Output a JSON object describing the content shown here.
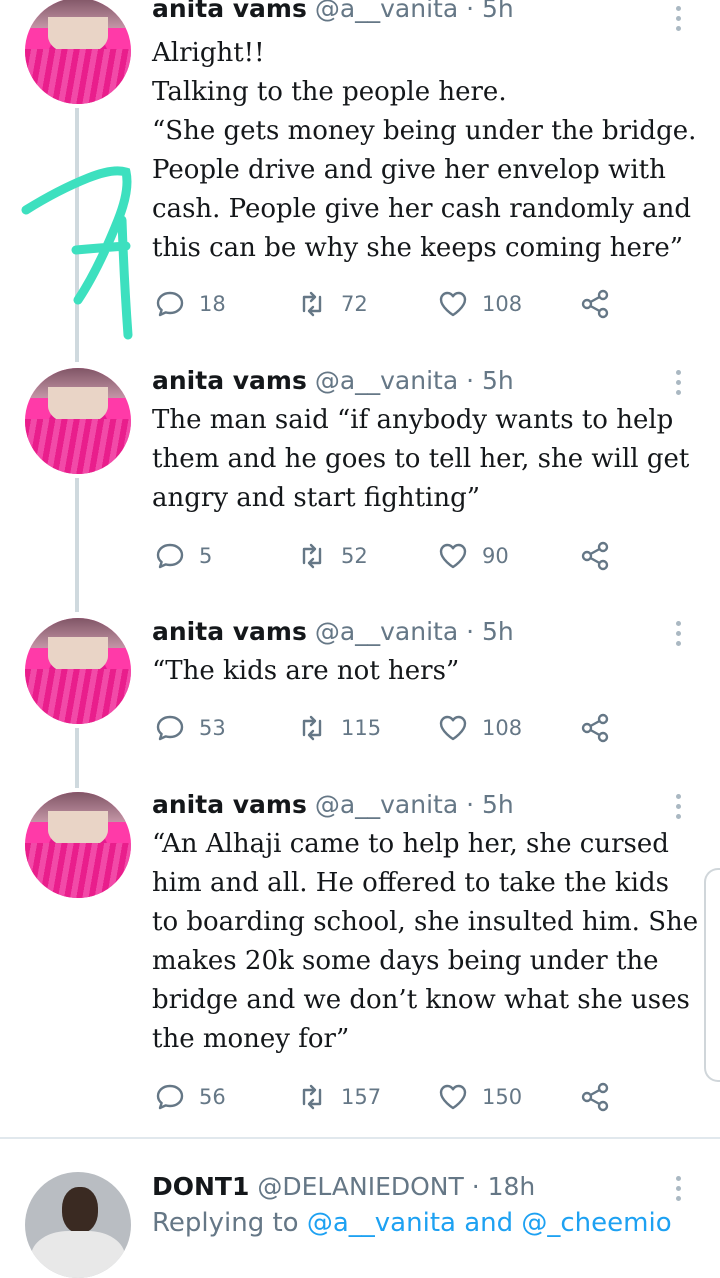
{
  "tweets": [
    {
      "name": "anita vams",
      "handle": "@a__vanita",
      "time": "· 5h",
      "lines": [
        "Alright!!",
        "Talking to the people here.",
        "“She gets money being under the bridge.",
        "People drive and give her envelop with",
        "cash. People give her cash randomly and",
        "this can be why she keeps coming here”"
      ],
      "replies": "18",
      "retweets": "72",
      "likes": "108"
    },
    {
      "name": "anita vams",
      "handle": "@a__vanita",
      "time": "· 5h",
      "lines": [
        "The man said “if anybody wants to help",
        "them and he goes to tell her, she will get",
        "angry and start fighting”"
      ],
      "replies": "5",
      "retweets": "52",
      "likes": "90"
    },
    {
      "name": "anita vams",
      "handle": "@a__vanita",
      "time": "· 5h",
      "lines": [
        "“The kids are not hers”"
      ],
      "replies": "53",
      "retweets": "115",
      "likes": "108"
    },
    {
      "name": "anita vams",
      "handle": "@a__vanita",
      "time": "· 5h",
      "lines": [
        "“An Alhaji came to help her, she cursed",
        "him and all. He offered to take the kids",
        "to boarding school, she insulted him. She",
        "makes 20k some days being under the",
        "bridge and we don’t know what she uses",
        "the money for”"
      ],
      "replies": "56",
      "retweets": "157",
      "likes": "150"
    }
  ],
  "next_tweet": {
    "name": "DONT1",
    "handle": "@DELANIEDONT",
    "time": "· 18h",
    "replying_prefix": "Replying to",
    "replying_to": "@a__vanita and @_cheemio"
  },
  "icons": {
    "reply": "reply-icon",
    "retweet": "retweet-icon",
    "like": "heart-icon",
    "share": "share-icon",
    "more": "more-vertical-icon"
  },
  "colors": {
    "accent": "#1da1f2",
    "meta": "#657786",
    "scribble": "#3de0bf"
  }
}
